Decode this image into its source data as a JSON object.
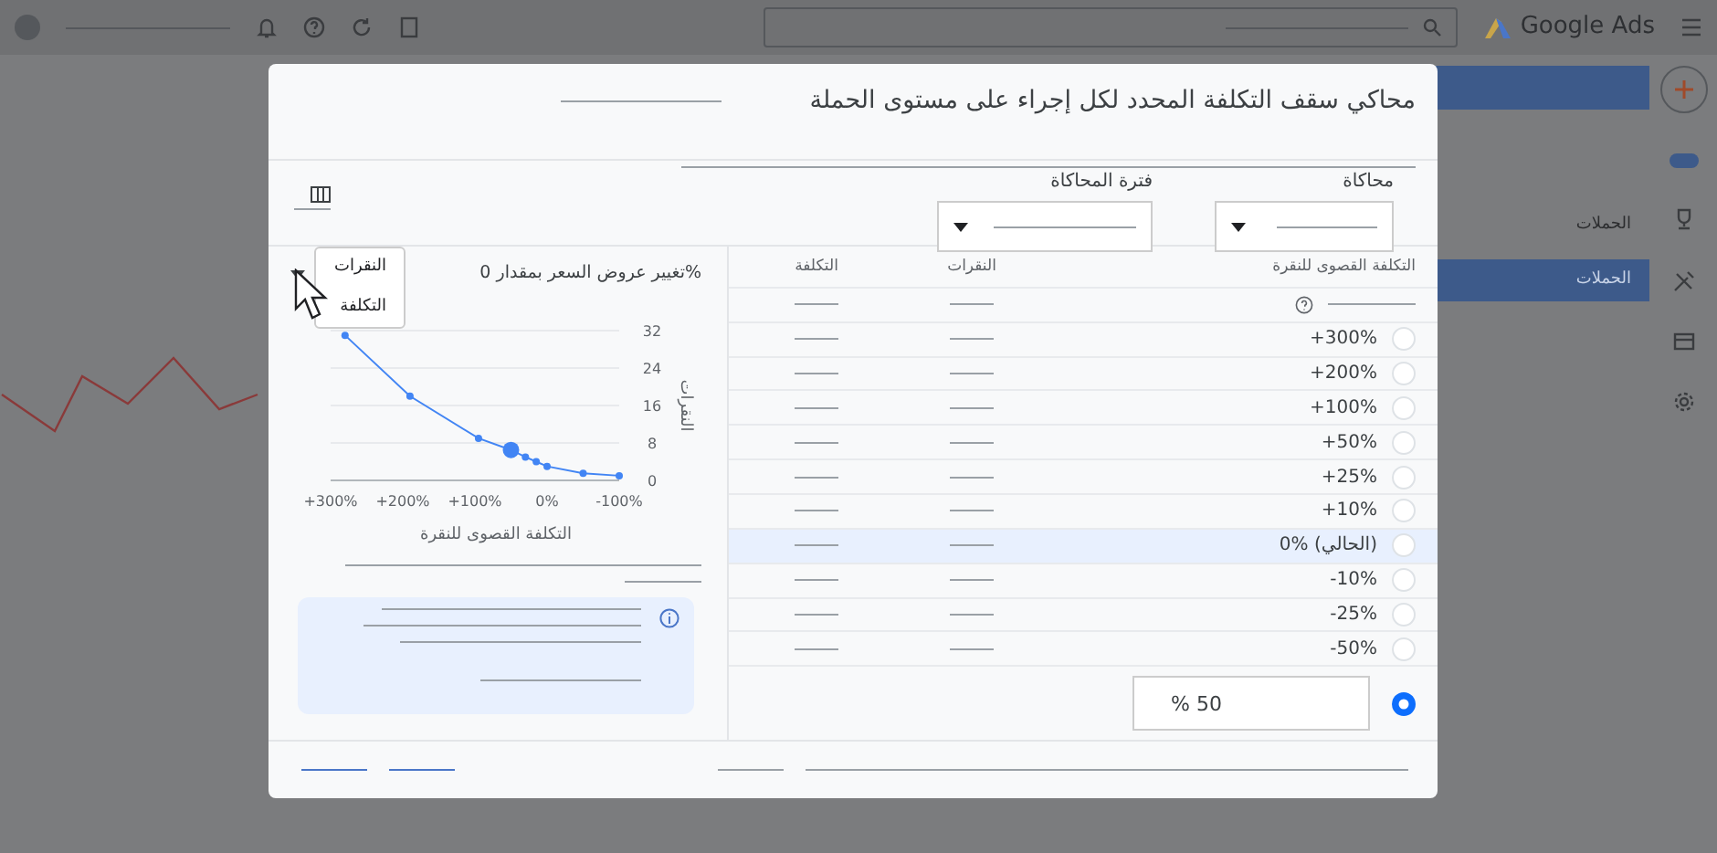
{
  "background": {
    "app_name": "Google Ads",
    "sidebar": [
      {
        "label": "الحملات",
        "selected": false
      },
      {
        "label": "الحملات",
        "selected": true
      }
    ]
  },
  "dialog": {
    "title": "محاكي سقف التكلفة المحدد لكل إجراء على مستوى الحملة",
    "controls": [
      {
        "label": "محاكاة"
      },
      {
        "label": "فترة المحاكاة"
      }
    ],
    "table": {
      "columns": [
        "التكلفة القصوى للنقرة",
        "النقرات",
        "التكلفة"
      ],
      "rows": [
        {
          "label": "+300%",
          "selected": false,
          "current": false
        },
        {
          "label": "+200%",
          "selected": false,
          "current": false
        },
        {
          "label": "+100%",
          "selected": false,
          "current": false
        },
        {
          "label": "+50%",
          "selected": false,
          "current": false
        },
        {
          "label": "+25%",
          "selected": false,
          "current": false
        },
        {
          "label": "+10%",
          "selected": false,
          "current": false
        },
        {
          "label": "0% (الحالي)",
          "selected": false,
          "current": true
        },
        {
          "label": "-10%",
          "selected": false,
          "current": false
        },
        {
          "label": "-25%",
          "selected": false,
          "current": false
        },
        {
          "label": "-50%",
          "selected": false,
          "current": false
        }
      ],
      "custom": {
        "value": "% 50",
        "selected": true
      }
    },
    "chart_panel": {
      "title": "%تغيير عروض السعر بمقدار 0",
      "points": [
        {
          "selected": false
        },
        {
          "selected": false
        },
        {
          "selected": false
        },
        {
          "selected": true
        },
        {
          "selected": false
        },
        {
          "selected": false
        },
        {
          "selected": false
        },
        {
          "selected": false
        },
        {
          "selected": false
        }
      ],
      "menu": [
        {
          "label": "النقرات"
        },
        {
          "label": "التكلفة"
        }
      ],
      "chart_data": {
        "type": "line",
        "xlabel": "التكلفة القصوى للنقرة",
        "ylabel": "النقرات",
        "x": [
          280,
          190,
          95,
          50,
          30,
          15,
          0,
          -50,
          -100
        ],
        "series": [
          {
            "color": "#4285f4",
            "marker": true,
            "values": [
              31,
              18,
              9,
              6.5,
              5,
              4,
              3,
              1.5,
              1
            ]
          }
        ],
        "grid": true,
        "xlim": [
          300,
          -100
        ],
        "ylim": [
          0,
          32
        ],
        "xticks": [
          {
            "value": 300,
            "label": "+300%"
          },
          {
            "value": 200,
            "label": "+200%"
          },
          {
            "value": 100,
            "label": "+100%"
          },
          {
            "value": 0,
            "label": "0%"
          },
          {
            "value": -100,
            "label": "-100%"
          }
        ],
        "yticks": [
          0,
          8,
          16,
          24,
          32
        ]
      }
    }
  }
}
